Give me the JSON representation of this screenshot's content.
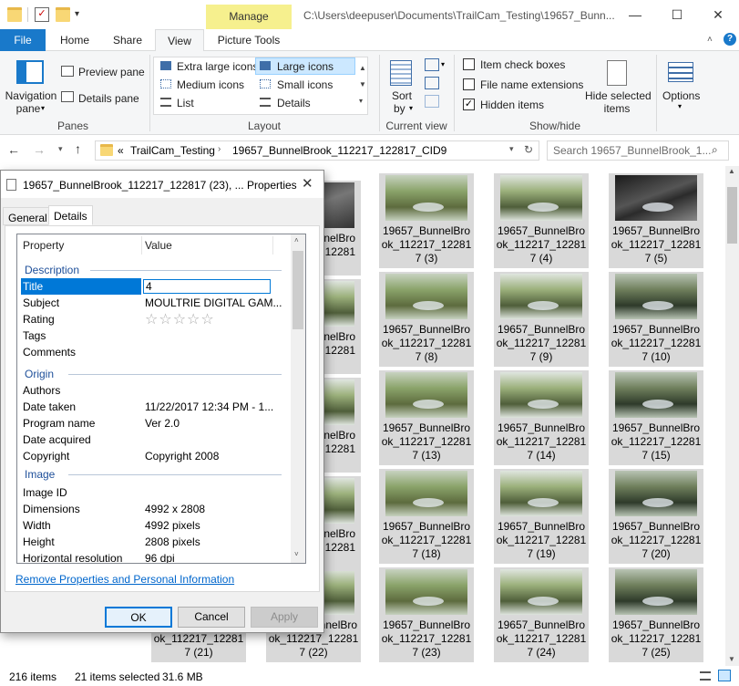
{
  "window": {
    "manage_label": "Manage",
    "path": "C:\\Users\\deepuser\\Documents\\TrailCam_Testing\\19657_Bunn...",
    "minimize": "—",
    "maximize": "☐",
    "close": "✕"
  },
  "ribbon_tabs": {
    "file": "File",
    "home": "Home",
    "share": "Share",
    "view": "View",
    "picture_tools": "Picture Tools"
  },
  "ribbon": {
    "nav_pane": "Navigation",
    "nav_pane2": "pane",
    "preview_pane": "Preview pane",
    "details_pane": "Details pane",
    "panes_label": "Panes",
    "extra_large": "Extra large icons",
    "large": "Large icons",
    "medium": "Medium icons",
    "small": "Small icons",
    "list": "List",
    "details": "Details",
    "layout_label": "Layout",
    "sort_by": "Sort",
    "sort_by2": "by",
    "current_view_label": "Current view",
    "item_checkboxes": "Item check boxes",
    "file_name_ext": "File name extensions",
    "hidden_items": "Hidden items",
    "hide_selected": "Hide selected",
    "hide_selected2": "items",
    "show_hide_label": "Show/hide",
    "options": "Options"
  },
  "address": {
    "crumb_prefix": "«",
    "crumb1": "TrailCam_Testing",
    "crumb2": "19657_BunnelBrook_112217_122817_CID9",
    "search_placeholder": "Search 19657_BunnelBrook_1..."
  },
  "thumbnails": [
    {
      "l1": "19657_BunnelBro",
      "l2": "ok_112217_12281",
      "l3": "7 (3)"
    },
    {
      "l1": "19657_BunnelBro",
      "l2": "ok_112217_12281",
      "l3": "7 (4)"
    },
    {
      "l1": "19657_BunnelBro",
      "l2": "ok_112217_12281",
      "l3": "7 (5)"
    },
    {
      "l1": "19657_BunnelBro",
      "l2": "ok_112217_12281",
      "l3": "7 (8)"
    },
    {
      "l1": "19657_BunnelBro",
      "l2": "ok_112217_12281",
      "l3": "7 (9)"
    },
    {
      "l1": "19657_BunnelBro",
      "l2": "ok_112217_12281",
      "l3": "7 (10)"
    },
    {
      "l1": "19657_BunnelBro",
      "l2": "ok_112217_12281",
      "l3": "7 (13)"
    },
    {
      "l1": "19657_BunnelBro",
      "l2": "ok_112217_12281",
      "l3": "7 (14)"
    },
    {
      "l1": "19657_BunnelBro",
      "l2": "ok_112217_12281",
      "l3": "7 (15)"
    },
    {
      "l1": "19657_BunnelBro",
      "l2": "ok_112217_12281",
      "l3": "7 (18)"
    },
    {
      "l1": "19657_BunnelBro",
      "l2": "ok_112217_12281",
      "l3": "7 (19)"
    },
    {
      "l1": "19657_BunnelBro",
      "l2": "ok_112217_12281",
      "l3": "7 (20)"
    },
    {
      "l1": "19657_BunnelBro",
      "l2": "ok_112217_12281",
      "l3": "7 (23)"
    },
    {
      "l1": "19657_BunnelBro",
      "l2": "ok_112217_12281",
      "l3": "7 (24)"
    },
    {
      "l1": "19657_BunnelBro",
      "l2": "ok_112217_12281",
      "l3": "7 (25)"
    }
  ],
  "left_partial": [
    {
      "l1": "19657_BunnelBro",
      "l2": "ok_112217_12281",
      "l3": "7 (21)"
    },
    {
      "l1": "19657_BunnelBro",
      "l2": "ok_112217_12281",
      "l3": "7 (22)"
    }
  ],
  "left_fragments": [
    "nelBro",
    "12281",
    "nelBro",
    "12281",
    "nelBro",
    "12281",
    "nelBro",
    "12281"
  ],
  "status": {
    "items": "216 items",
    "selected": "21 items selected",
    "size": "31.6 MB"
  },
  "dialog": {
    "title": "19657_BunnelBrook_112217_122817 (23), ... Properties",
    "tab_general": "General",
    "tab_details": "Details",
    "col_property": "Property",
    "col_value": "Value",
    "sec_description": "Description",
    "sec_origin": "Origin",
    "sec_image": "Image",
    "rows": {
      "title_k": "Title",
      "title_v": "4",
      "subject_k": "Subject",
      "subject_v": "MOULTRIE DIGITAL GAM...",
      "rating_k": "Rating",
      "rating_v": "☆☆☆☆☆",
      "tags_k": "Tags",
      "comments_k": "Comments",
      "authors_k": "Authors",
      "date_taken_k": "Date taken",
      "date_taken_v": "11/22/2017 12:34 PM - 1...",
      "program_k": "Program name",
      "program_v": "Ver 2.0",
      "date_acq_k": "Date acquired",
      "copyright_k": "Copyright",
      "copyright_v": "Copyright 2008",
      "image_id_k": "Image ID",
      "dimensions_k": "Dimensions",
      "dimensions_v": "4992 x 2808",
      "width_k": "Width",
      "width_v": "4992 pixels",
      "height_k": "Height",
      "height_v": "2808 pixels",
      "hres_k": "Horizontal resolution",
      "hres_v": "96 dpi"
    },
    "remove_link": "Remove Properties and Personal Information",
    "ok": "OK",
    "cancel": "Cancel",
    "apply": "Apply"
  }
}
